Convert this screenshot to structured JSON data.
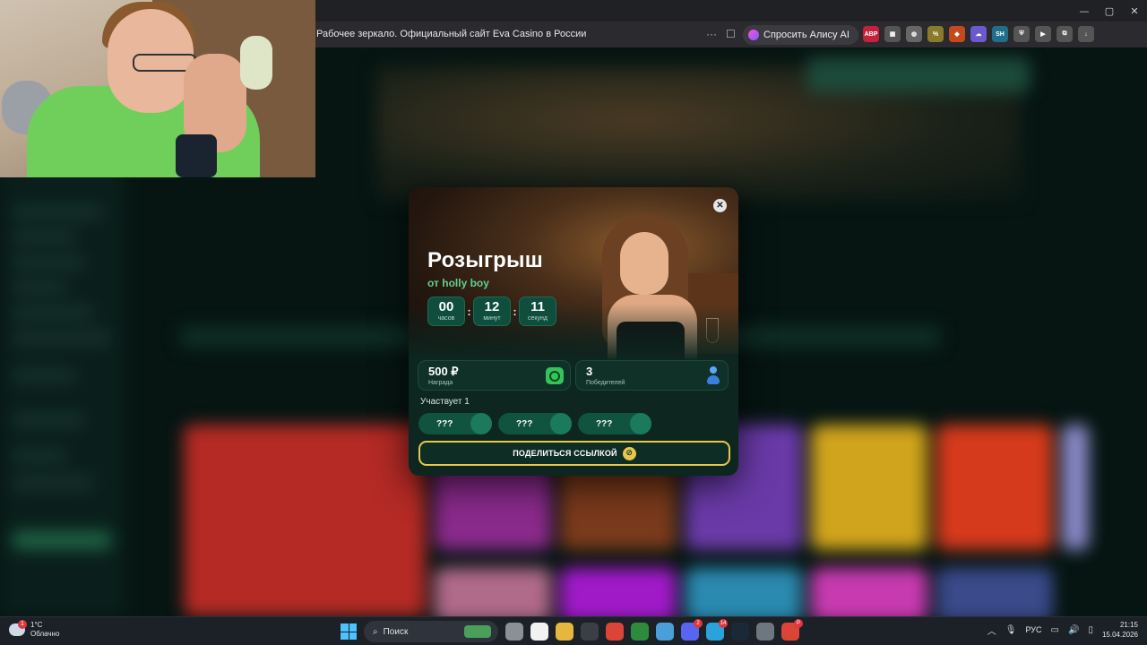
{
  "browser": {
    "tab_title": "Рабочее зеркало. Официальный сайт Eva Casino в России",
    "more_symbol": "···",
    "bookmark_symbol": "☐",
    "alice_label": "Спросить Алису AI",
    "window_controls": [
      "—",
      "▢",
      "✕"
    ],
    "extensions": [
      {
        "name": "abp-extension-icon",
        "text": "ABP",
        "color": "#c7203a"
      },
      {
        "name": "qr-extension-icon",
        "text": "▦",
        "color": "#555"
      },
      {
        "name": "globe-extension-icon",
        "text": "◍",
        "color": "#666"
      },
      {
        "name": "percent-extension-icon",
        "text": "%",
        "color": "#8a7a2a"
      },
      {
        "name": "fox-extension-icon",
        "text": "◆",
        "color": "#c44a1e"
      },
      {
        "name": "cloud-extension-icon",
        "text": "☁",
        "color": "#6a5acd"
      },
      {
        "name": "sh-extension-icon",
        "text": "SH",
        "color": "#1f6f8b"
      },
      {
        "name": "shield-extension-icon",
        "text": "⛨",
        "color": "#555"
      },
      {
        "name": "media-extension-icon",
        "text": "▶",
        "color": "#555"
      },
      {
        "name": "puzzle-extension-icon",
        "text": "⧉",
        "color": "#555"
      },
      {
        "name": "download-extension-icon",
        "text": "↓",
        "color": "#555"
      }
    ]
  },
  "modal": {
    "close_symbol": "✕",
    "title": "Розыгрыш",
    "subtitle": "от holly boy",
    "timer": {
      "hours": "00",
      "hours_label": "часов",
      "minutes": "12",
      "minutes_label": "минут",
      "seconds": "11",
      "seconds_label": "секунд",
      "separator": ":"
    },
    "prize": {
      "value": "500 ₽",
      "label": "Награда"
    },
    "winners": {
      "value": "3",
      "label": "Победителей"
    },
    "participants": "Участвует 1",
    "slots": [
      "???",
      "???",
      "???"
    ],
    "share_label": "ПОДЕЛИТЬСЯ ССЫЛКОЙ",
    "share_icon": "⊘"
  },
  "taskbar": {
    "weather_temp": "1°C",
    "weather_desc": "Облачно",
    "weather_badge": "1",
    "search_placeholder": "Поиск",
    "search_symbol": "⌕",
    "apps": [
      {
        "name": "file-explorer-gray-icon",
        "color": "#8a8f98",
        "badge": ""
      },
      {
        "name": "yandex-browser-icon",
        "color": "#f2f2f2",
        "badge": ""
      },
      {
        "name": "folder-icon",
        "color": "#e6b73c",
        "badge": ""
      },
      {
        "name": "obs-icon",
        "color": "#3a3f47",
        "badge": ""
      },
      {
        "name": "chrome-icon",
        "color": "#db4437",
        "badge": ""
      },
      {
        "name": "xbox-icon",
        "color": "#2e8b3e",
        "badge": ""
      },
      {
        "name": "media-app-icon",
        "color": "#4a9fd8",
        "badge": ""
      },
      {
        "name": "discord-icon",
        "color": "#5865f2",
        "badge": "2"
      },
      {
        "name": "telegram-icon",
        "color": "#2aa3dd",
        "badge": "14"
      },
      {
        "name": "steam-icon",
        "color": "#1b2838",
        "badge": ""
      },
      {
        "name": "settings-icon",
        "color": "#6e7680",
        "badge": ""
      },
      {
        "name": "chrome-profile-icon",
        "color": "#db4437",
        "badge": "P"
      }
    ],
    "tray_chevron": "︿",
    "mic_symbol": "🎙",
    "language": "РУС",
    "net_symbol": "▭",
    "volume_symbol": "🔊",
    "battery_symbol": "▯",
    "time": "21:15",
    "date": "15.04.2026"
  }
}
